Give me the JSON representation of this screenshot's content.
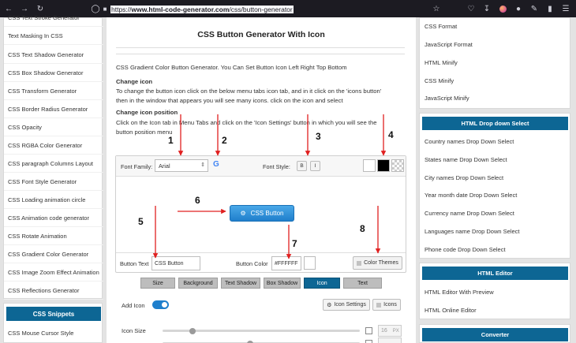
{
  "browser": {
    "url_prefix": "https://",
    "url_host": "www.html-code-generator.com",
    "url_path": "/css/button-generator"
  },
  "left_sidebar": {
    "items": [
      "CSS Text Stroke Generator",
      "Text Masking In CSS",
      "CSS Text Shadow Generator",
      "CSS Box Shadow Generator",
      "CSS Transform Generator",
      "CSS Border Radius Generator",
      "CSS Opacity",
      "CSS RGBA Color Generator",
      "CSS paragraph Columns Layout",
      "CSS Font Style Generator",
      "CSS Loading animation circle",
      "CSS Animation code generator",
      "CSS Rotate Animation",
      "CSS Gradient Color Generator",
      "CSS Image Zoom Effect Animation",
      "CSS Reflections Generator"
    ],
    "snippets_heading": "CSS Snippets",
    "snippets_item": "CSS Mouse Cursor Style"
  },
  "main": {
    "title": "CSS Button Generator With Icon",
    "intro": "CSS Gradient Color Button Generator. You Can Set Button Icon Left Right Top Bottom",
    "change_icon_heading": "Change icon",
    "change_icon_text_1": "To change the button icon click on the below menu tabs icon tab, and in it click on the 'icons button'",
    "change_icon_text_2": "then in the window that appears you will see many icons. click on the icon and select",
    "change_pos_heading": "Change icon position",
    "change_pos_text_1": "Click on the Icon tab in Menu Tabs and click on the 'Icon Settings' button in which you will see the",
    "change_pos_text_2": "button position menu",
    "font_family_label": "Font Family:",
    "font_family_value": "Arial",
    "google_icon": "G",
    "font_style_label": "Font Style:",
    "bold_label": "B",
    "italic_label": "I",
    "preview_button_label": "CSS Button",
    "button_text_label": "Button Text",
    "button_text_value": "CSS Button",
    "button_color_label": "Button Color",
    "button_color_value": "#FFFFFF",
    "color_themes_label": "Color Themes",
    "tabs": [
      "Size",
      "Background",
      "Text Shadow",
      "Box Shadow",
      "Icon",
      "Text"
    ],
    "active_tab": "Icon",
    "add_icon_label": "Add Icon",
    "icon_settings_label": "Icon Settings",
    "icons_label": "Icons",
    "icon_size_label": "Icon Size",
    "icon_size_value": "16",
    "icon_size_unit": "PX",
    "icon_size_level": 0.15
  },
  "right_sidebar": {
    "top_items": [
      "CSS Format",
      "JavaScript Format",
      "HTML Minify",
      "CSS Minify",
      "JavaScript Minify"
    ],
    "dropdown_heading": "HTML Drop down Select",
    "dropdown_items": [
      "Country names Drop Down Select",
      "States name Drop Down Select",
      "City names Drop Down Select",
      "Year month date Drop Down Select",
      "Currency name Drop Down Select",
      "Languages name Drop Down Select",
      "Phone code Drop Down Select"
    ],
    "editor_heading": "HTML Editor",
    "editor_items": [
      "HTML Editor With Preview",
      "HTML Online Editor"
    ],
    "converter_heading": "Converter"
  },
  "annotations": [
    "1",
    "2",
    "3",
    "4",
    "5",
    "6",
    "7",
    "8"
  ],
  "colors": {
    "accent": "#0d6694",
    "annotation_arrow": "#e02020",
    "button_gradient_top": "#4aa8e8",
    "button_gradient_bottom": "#1f7fcc"
  }
}
